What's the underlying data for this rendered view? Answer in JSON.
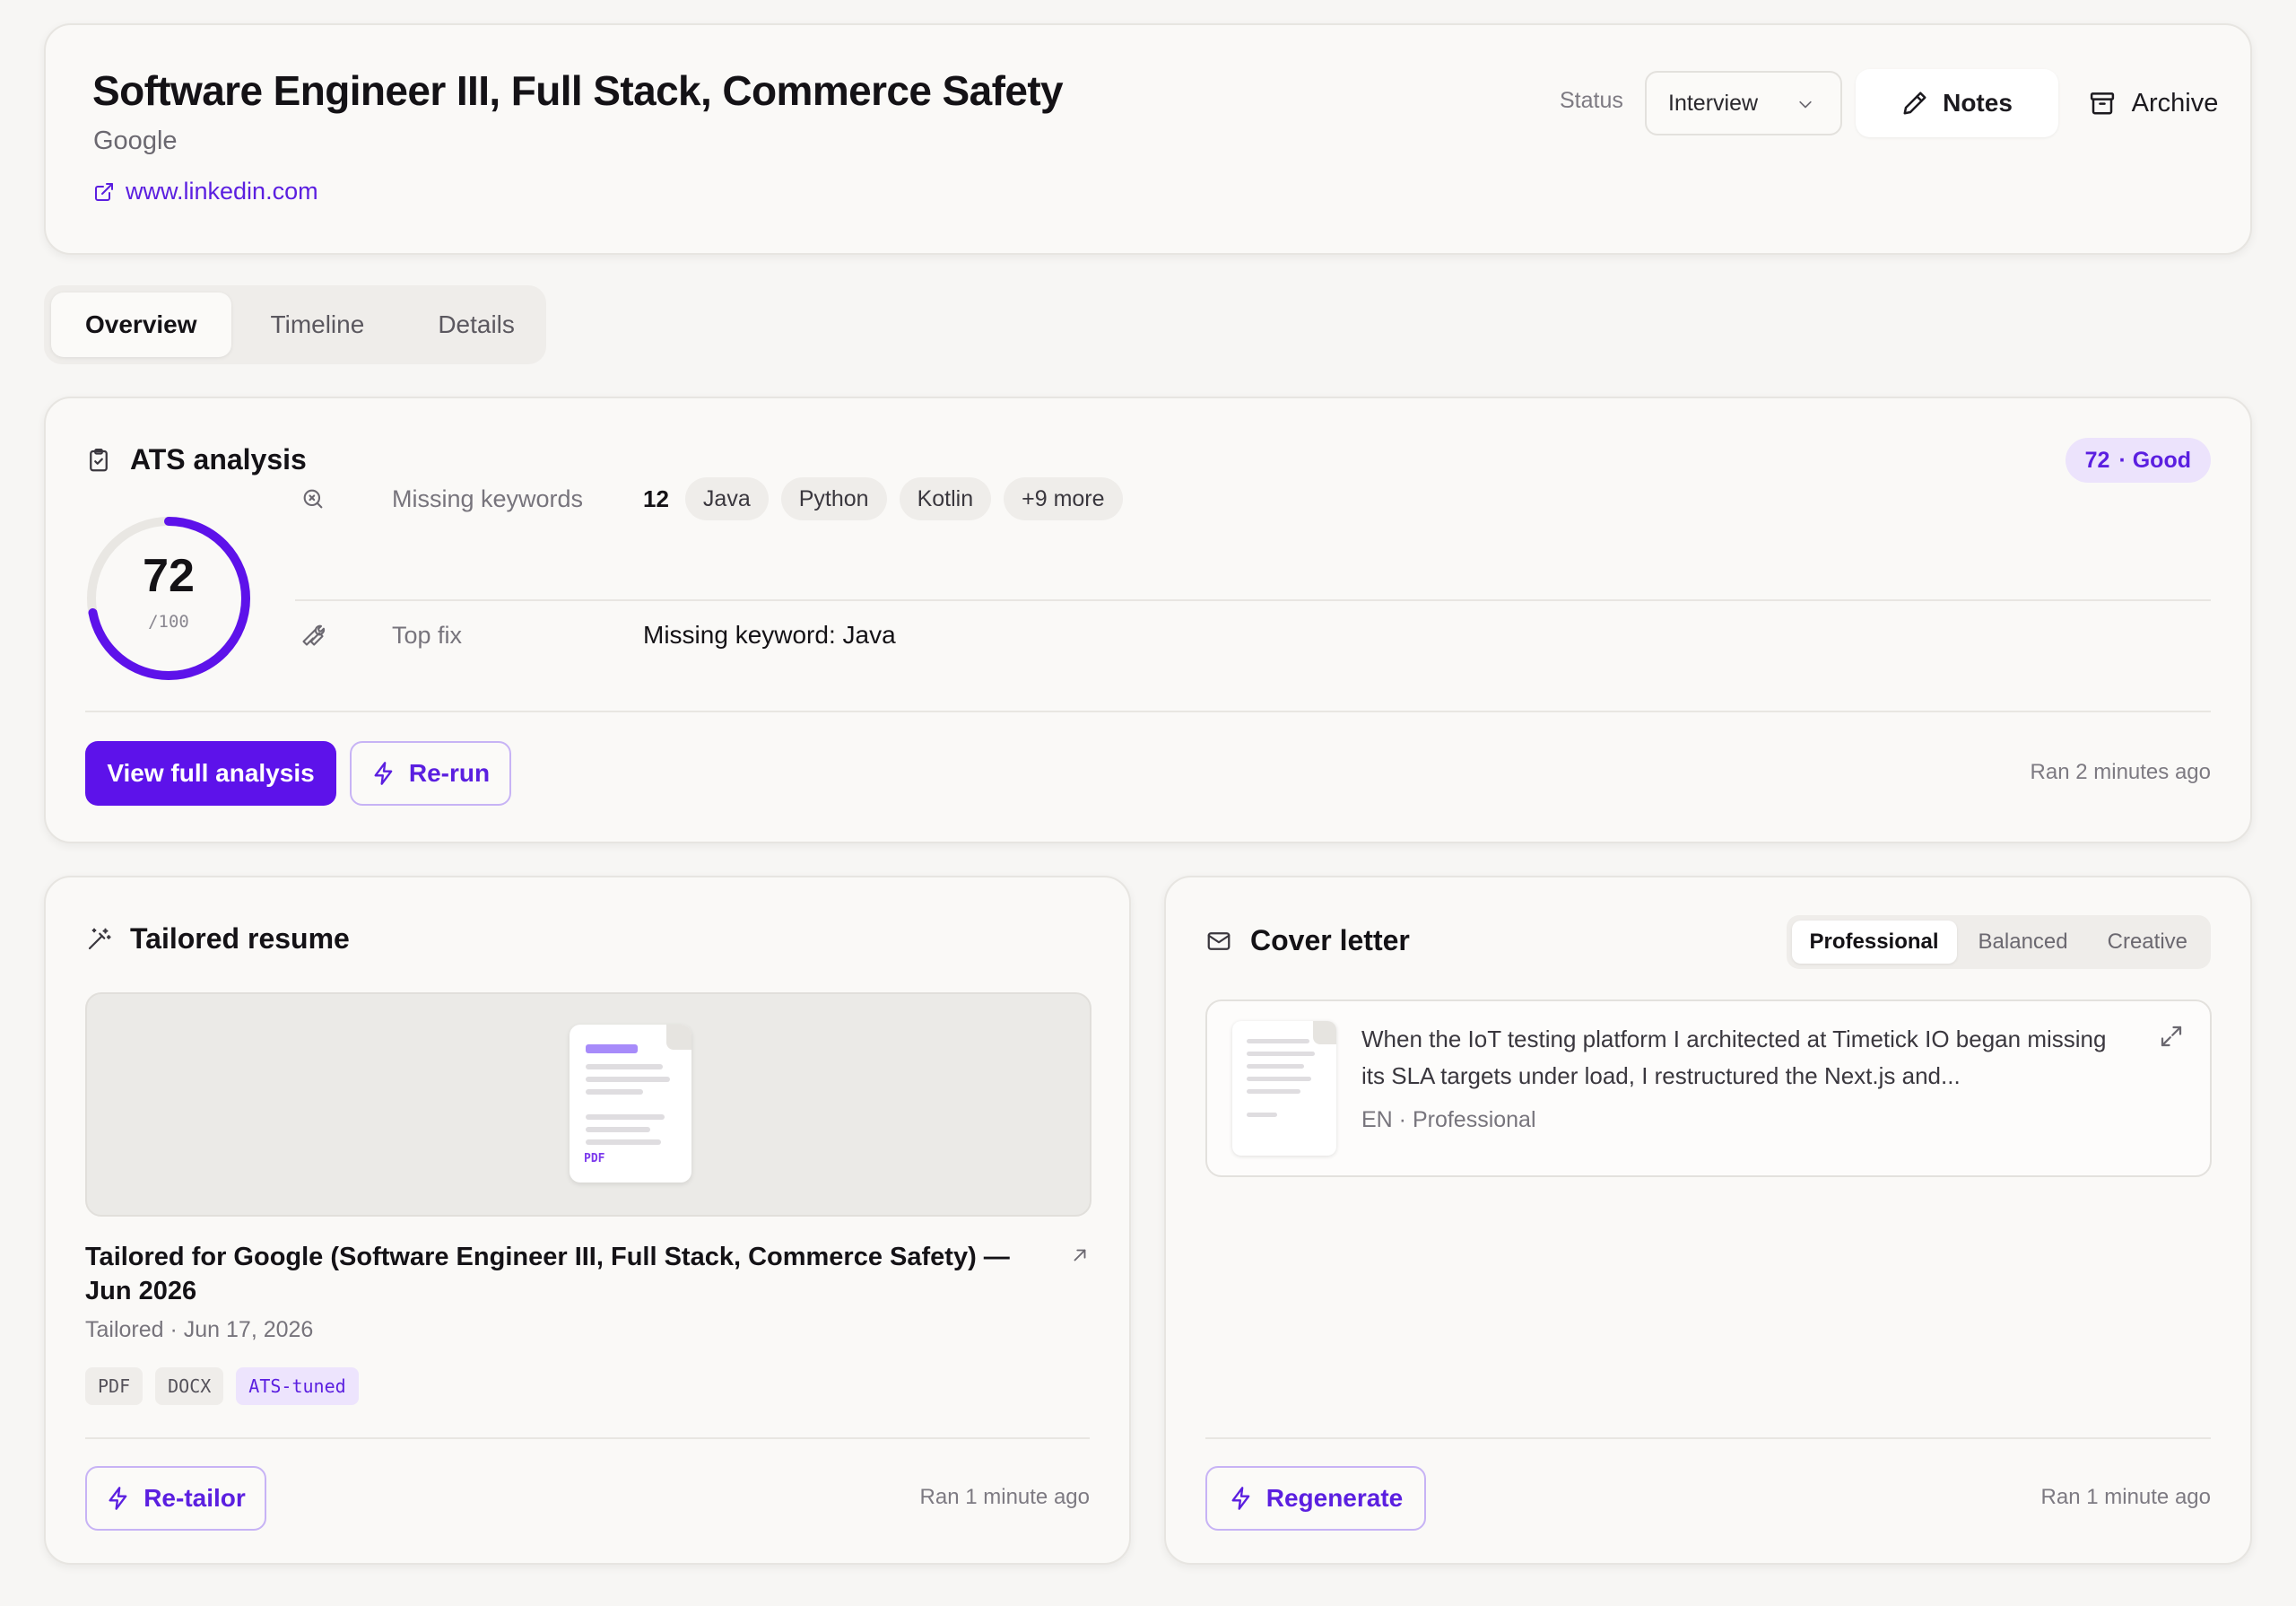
{
  "header": {
    "title": "Software Engineer III, Full Stack, Commerce Safety",
    "company": "Google",
    "link": "www.linkedin.com",
    "status_label": "Status",
    "status_value": "Interview",
    "notes_label": "Notes",
    "archive_label": "Archive"
  },
  "tabs": [
    {
      "label": "Overview",
      "active": true
    },
    {
      "label": "Timeline",
      "active": false
    },
    {
      "label": "Details",
      "active": false
    }
  ],
  "ats": {
    "title": "ATS analysis",
    "score_pill": {
      "score": "72",
      "rating": "· Good"
    },
    "score": 72,
    "score_text": "72",
    "score_max": "/100",
    "missing_label": "Missing keywords",
    "missing_count": "12",
    "keywords": [
      "Java",
      "Python",
      "Kotlin",
      "+9 more"
    ],
    "topfix_label": "Top fix",
    "topfix_value": "Missing keyword: Java",
    "view_button": "View full analysis",
    "rerun_button": "Re-run",
    "ran": "Ran 2 minutes ago"
  },
  "resume": {
    "title": "Tailored resume",
    "thumb_label": "PDF",
    "doc_title": "Tailored for Google (Software Engineer III, Full Stack, Commerce Safety) — Jun 2026",
    "meta": "Tailored · Jun 17, 2026",
    "tags": [
      "PDF",
      "DOCX",
      "ATS-tuned"
    ],
    "retailor_button": "Re-tailor",
    "ran": "Ran 1 minute ago"
  },
  "cover": {
    "title": "Cover letter",
    "tones": [
      {
        "label": "Professional",
        "active": true
      },
      {
        "label": "Balanced",
        "active": false
      },
      {
        "label": "Creative",
        "active": false
      }
    ],
    "preview": "When the IoT testing platform I architected at Timetick IO began missing its SLA targets under load, I restructured the Next.js and...",
    "meta": "EN · Professional",
    "regenerate_button": "Regenerate",
    "ran": "Ran 1 minute ago"
  },
  "colors": {
    "accent": "#5d12ea",
    "accent_text": "#5b1fe0",
    "accent_soft": "#ece3fc",
    "gauge_track": "#e9e7e3"
  },
  "icons": {
    "link": "external-link-icon",
    "select": "chevron-down-icon",
    "notes": "pencil-icon",
    "archive": "archive-icon",
    "ats": "clipboard-check-icon",
    "missing": "search-x-icon",
    "topfix": "wrench-icon",
    "rerun": "zap-icon",
    "resume": "magic-wand-icon",
    "open": "arrow-up-right-icon",
    "cover": "mail-icon",
    "expand": "maximize-icon"
  }
}
